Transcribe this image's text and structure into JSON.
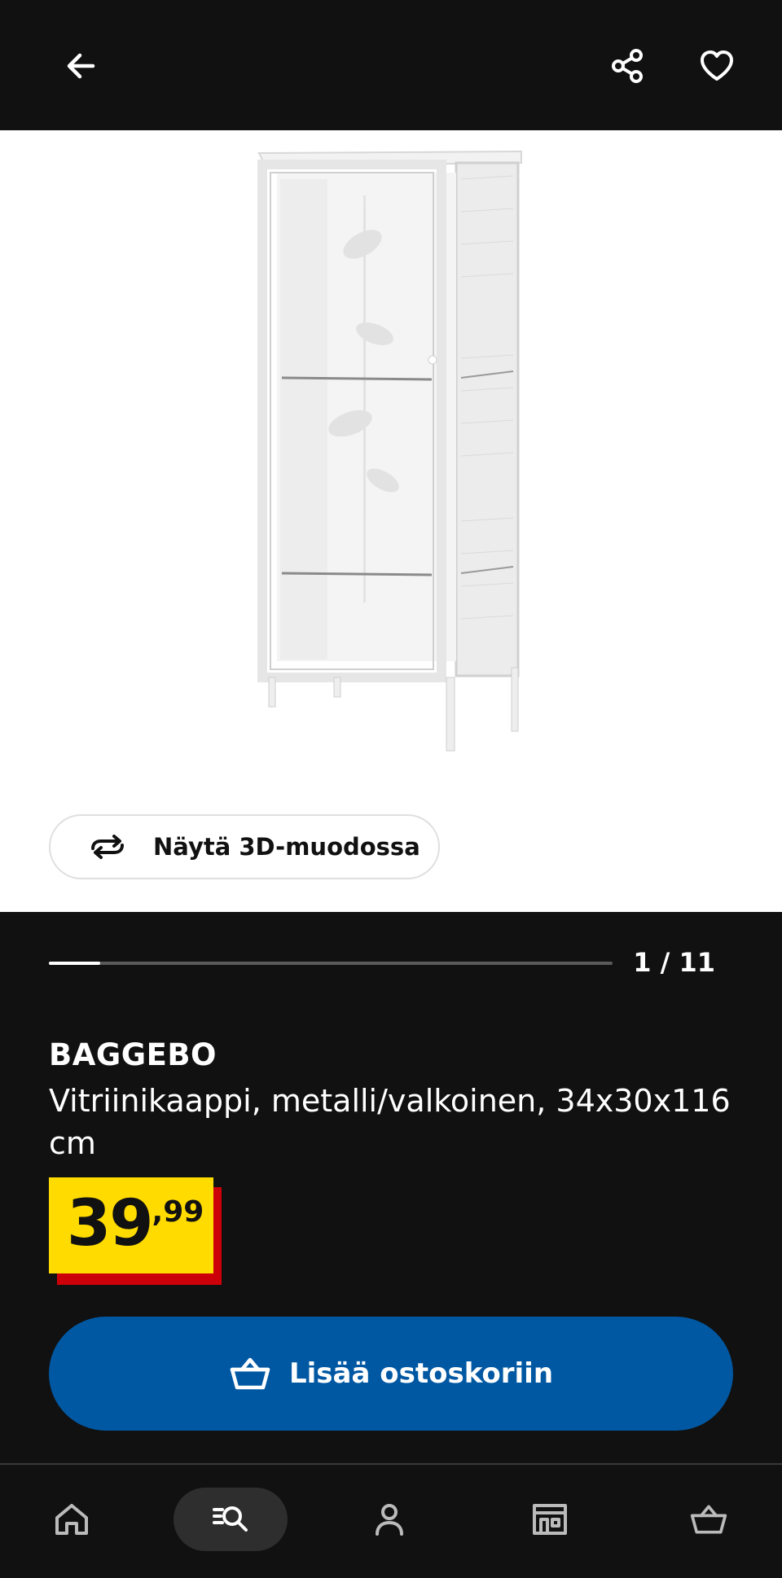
{
  "topbar": {
    "back_icon": "arrow-left-icon",
    "share_icon": "share-icon",
    "favorite_icon": "heart-icon"
  },
  "gallery": {
    "view_3d_label": "Näytä 3D-muodossa",
    "view_3d_icon": "rotate-3d-icon",
    "counter": "1 / 11",
    "progress_fraction": 0.0909
  },
  "product": {
    "name": "BAGGEBO",
    "description": "Vitriinikaappi, metalli/valkoinen, 34x30x116 cm",
    "price_integer": "39",
    "price_decimal": ",99"
  },
  "cart_button": {
    "label": "Lisää ostoskoriin",
    "icon": "basket-icon"
  },
  "bottom_nav": {
    "items": [
      {
        "name": "home",
        "icon": "home-icon",
        "active": false
      },
      {
        "name": "search",
        "icon": "search-icon",
        "active": true
      },
      {
        "name": "profile",
        "icon": "person-icon",
        "active": false
      },
      {
        "name": "stores",
        "icon": "store-icon",
        "active": false
      },
      {
        "name": "cart",
        "icon": "basket-icon",
        "active": false
      }
    ]
  },
  "colors": {
    "background": "#111111",
    "primary_blue": "#0058a3",
    "price_yellow": "#ffdb00",
    "price_red": "#cc0008"
  }
}
